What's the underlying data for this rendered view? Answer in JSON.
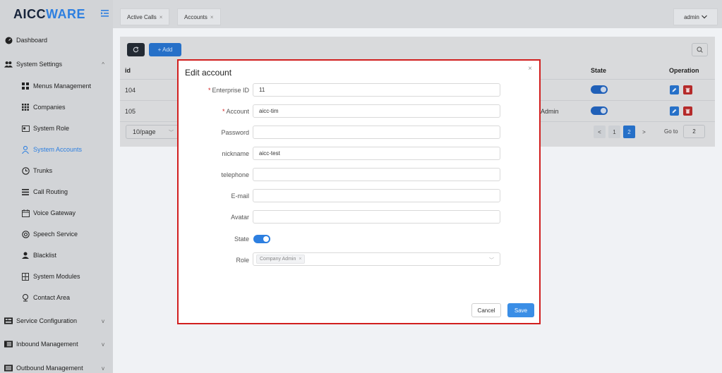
{
  "app": {
    "logo_main": "AICC",
    "logo_accent": "WARE"
  },
  "sidebar": {
    "items": [
      {
        "label": "Dashboard",
        "icon": "dashboard-icon"
      },
      {
        "label": "System Settings",
        "icon": "users-icon",
        "arrow": "^"
      },
      {
        "label": "Menus Management",
        "icon": "grid-icon"
      },
      {
        "label": "Companies",
        "icon": "grid9-icon"
      },
      {
        "label": "System Role",
        "icon": "id-card-icon"
      },
      {
        "label": "System Accounts",
        "icon": "user-icon"
      },
      {
        "label": "Trunks",
        "icon": "clock-icon"
      },
      {
        "label": "Call Routing",
        "icon": "list-icon"
      },
      {
        "label": "Voice Gateway",
        "icon": "calendar-icon"
      },
      {
        "label": "Speech Service",
        "icon": "globe-icon"
      },
      {
        "label": "Blacklist",
        "icon": "person-icon"
      },
      {
        "label": "System Modules",
        "icon": "modules-icon"
      },
      {
        "label": "Contact Area",
        "icon": "location-icon"
      },
      {
        "label": "Service Configuration",
        "icon": "keyboard-icon",
        "arrow": "v"
      },
      {
        "label": "Inbound Management",
        "icon": "inbound-icon",
        "arrow": "v"
      },
      {
        "label": "Outbound Management",
        "icon": "outbound-icon",
        "arrow": "v"
      }
    ]
  },
  "header": {
    "tabs": [
      {
        "label": "Active Calls",
        "close": "×"
      },
      {
        "label": "Accounts",
        "close": "×"
      }
    ],
    "user": "admin"
  },
  "toolbar": {
    "add_label": "+ Add"
  },
  "table": {
    "columns": {
      "id": "id",
      "state": "State",
      "operation": "Operation"
    },
    "rows": [
      {
        "id": "104",
        "role": ""
      },
      {
        "id": "105",
        "role": "Admin"
      }
    ]
  },
  "pagination": {
    "page_size": "10/page",
    "pages": [
      "<",
      "1",
      "2",
      ">"
    ],
    "current_page": "2",
    "goto_label": "Go to",
    "goto_value": "2"
  },
  "modal": {
    "title": "Edit account",
    "close": "×",
    "fields": {
      "enterprise_id": {
        "label": "Enterprise ID",
        "required": "*",
        "value": "11"
      },
      "account": {
        "label": "Account",
        "required": "*",
        "value": "aicc-tim"
      },
      "password": {
        "label": "Password",
        "value": ""
      },
      "nickname": {
        "label": "nickname",
        "value": "aicc-test"
      },
      "telephone": {
        "label": "telephone",
        "value": ""
      },
      "email": {
        "label": "E-mail",
        "value": ""
      },
      "avatar": {
        "label": "Avatar",
        "value": ""
      },
      "state": {
        "label": "State",
        "on": true
      },
      "role": {
        "label": "Role",
        "tag": "Company Admin",
        "tag_close": "×"
      }
    },
    "cancel_label": "Cancel",
    "save_label": "Save"
  },
  "colors": {
    "accent": "#2d7fe0",
    "highlight_border": "#d11f1f",
    "danger": "#b52a2a"
  }
}
